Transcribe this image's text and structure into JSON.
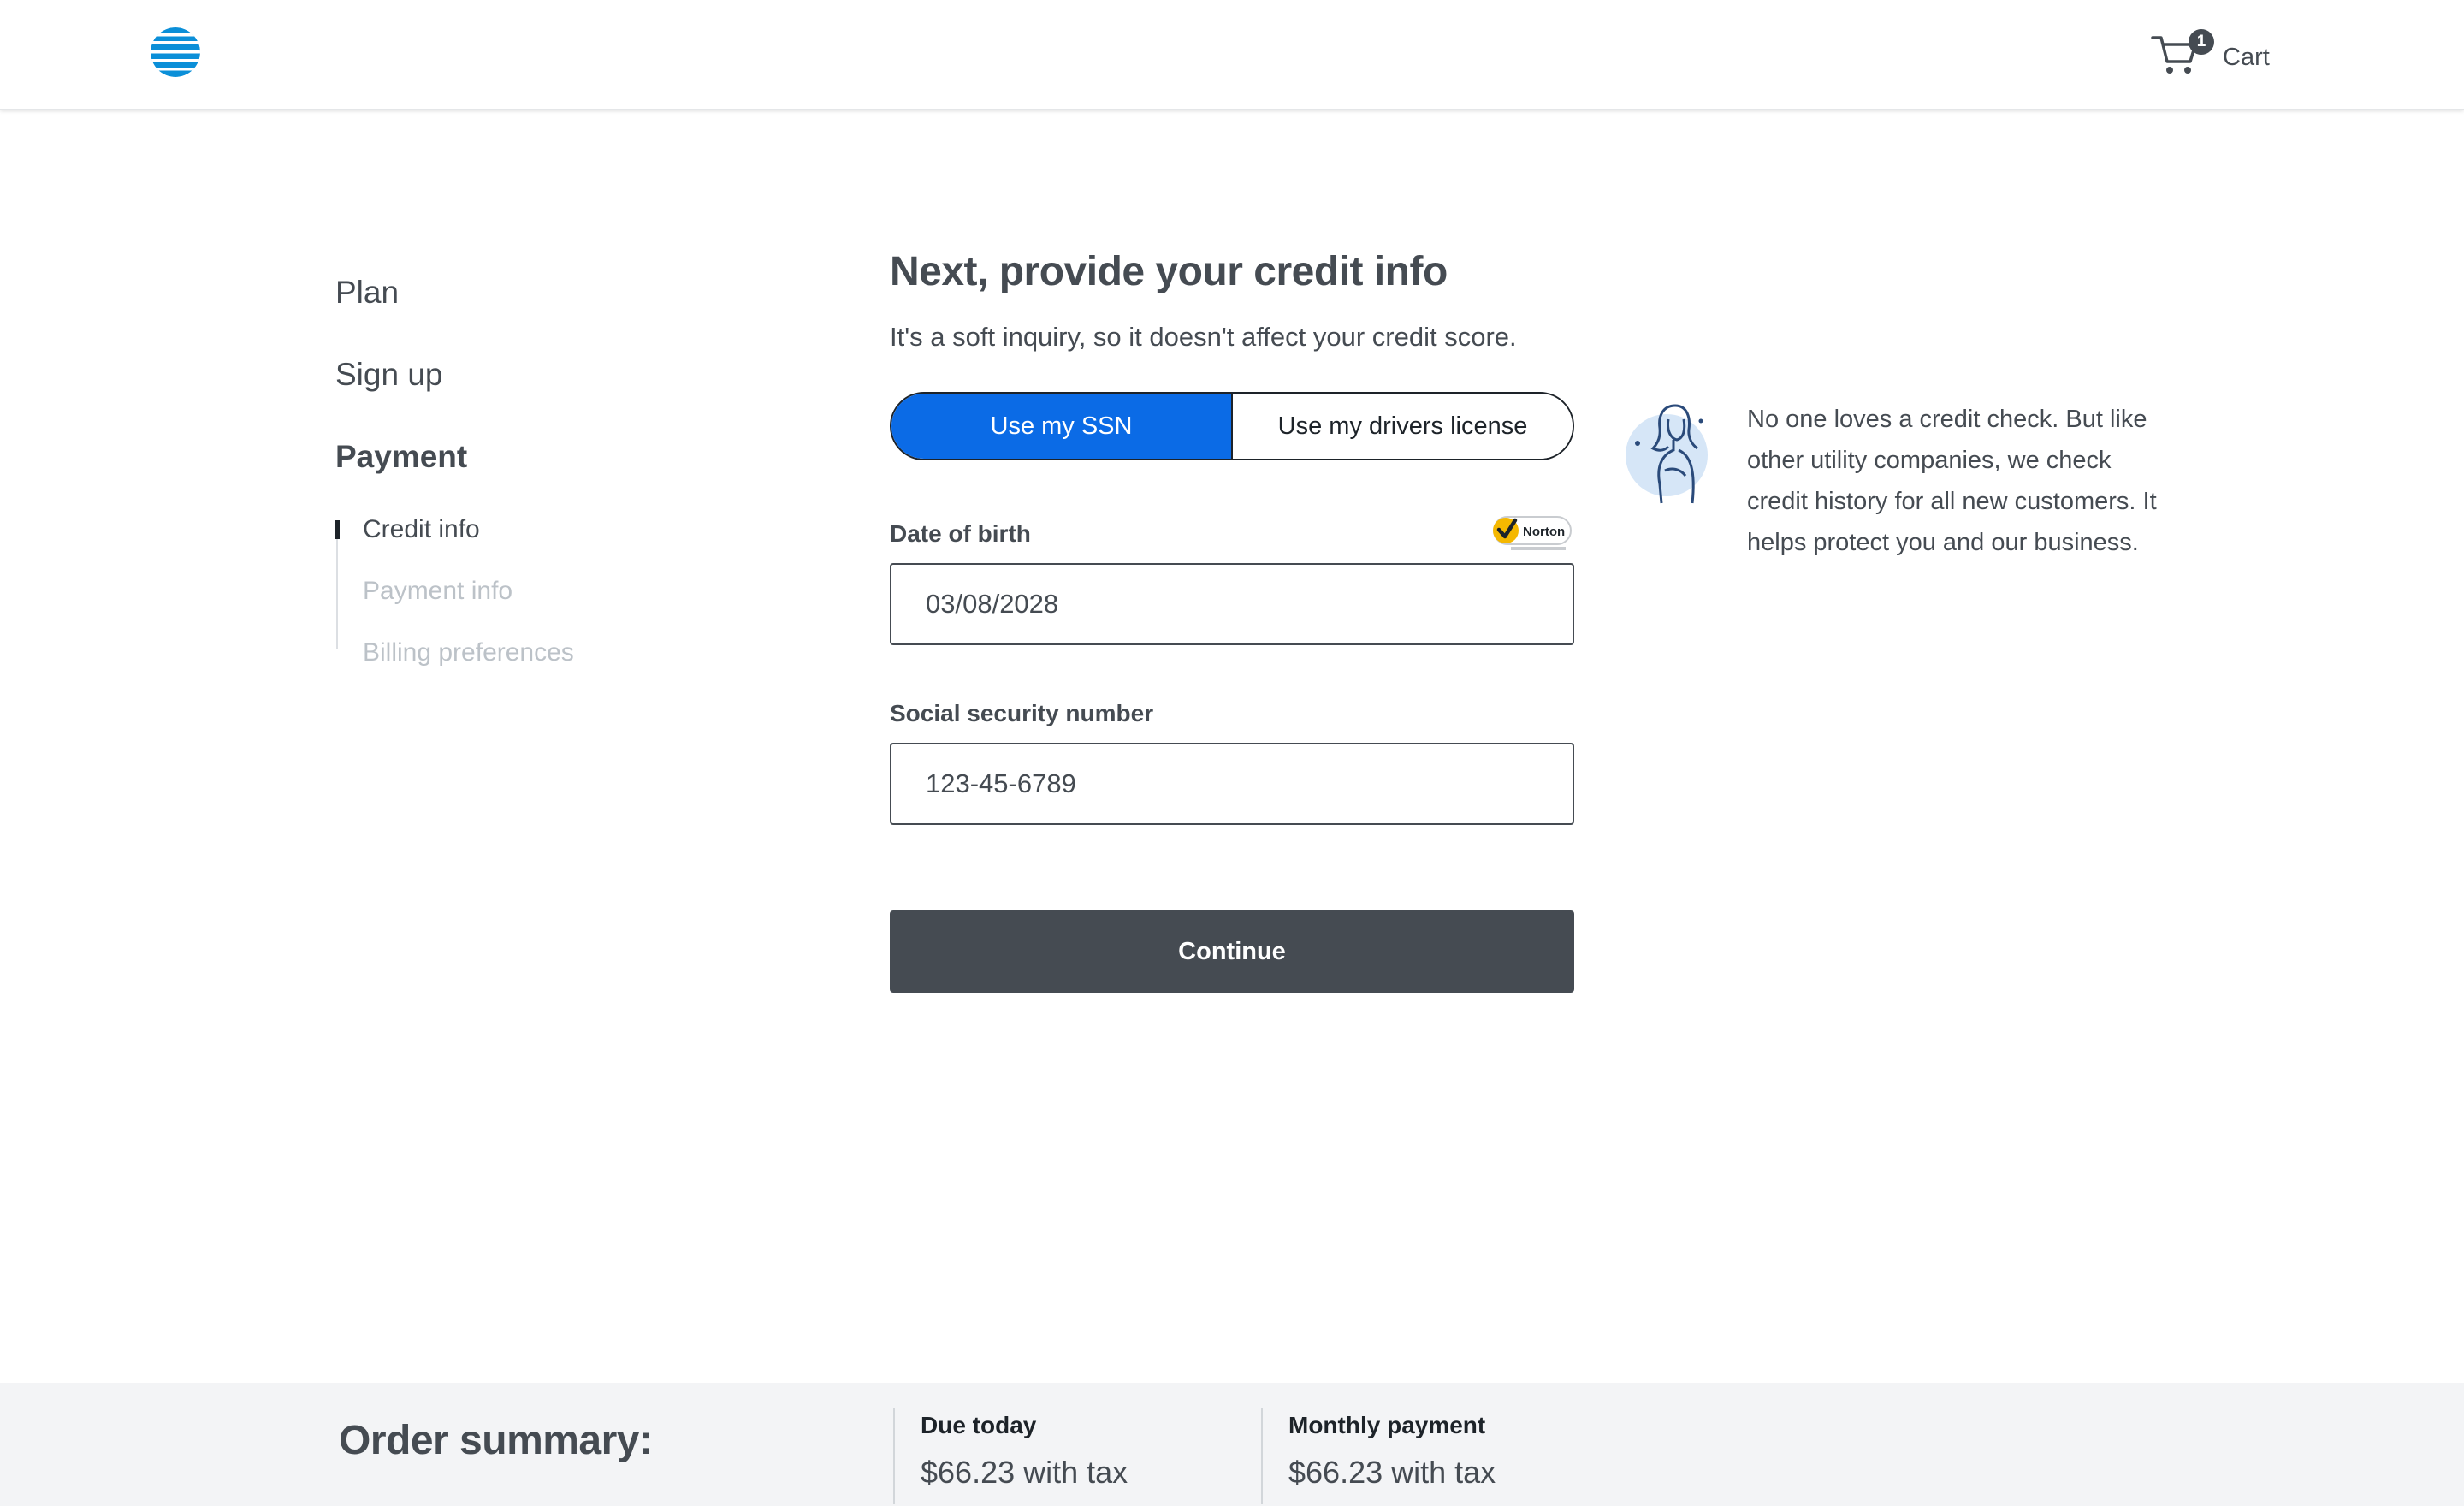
{
  "header": {
    "cart_count": "1",
    "cart_label": "Cart"
  },
  "nav": {
    "steps": [
      {
        "label": "Plan"
      },
      {
        "label": "Sign up"
      },
      {
        "label": "Payment"
      }
    ],
    "substeps": [
      {
        "label": "Credit info"
      },
      {
        "label": "Payment info"
      },
      {
        "label": "Billing preferences"
      }
    ]
  },
  "form": {
    "title": "Next, provide your credit info",
    "subtitle": "It's a soft inquiry, so it doesn't affect your credit score.",
    "toggle": {
      "option_ssn": "Use my SSN",
      "option_license": "Use my drivers license",
      "selected": "Use my SSN"
    },
    "dob_label": "Date of birth",
    "dob_value": "03/08/2028",
    "ssn_label": "Social security number",
    "ssn_value": "123-45-6789",
    "continue_label": "Continue",
    "norton_badge": "Norton"
  },
  "note": {
    "text": "No one loves a credit check. But like other utility companies, we check credit history for all new customers. It helps protect you and our business."
  },
  "summary": {
    "title": "Order summary:",
    "due_today_label": "Due today",
    "due_today_value": "$66.23 with tax",
    "monthly_label": "Monthly payment",
    "monthly_value": "$66.23 with tax"
  },
  "colors": {
    "accent": "#0B6BE6",
    "dark": "#454B52",
    "summary_bg": "#F3F4F6"
  },
  "icons": [
    "att-globe-logo",
    "cart-icon",
    "norton-badge",
    "person-illustration"
  ]
}
